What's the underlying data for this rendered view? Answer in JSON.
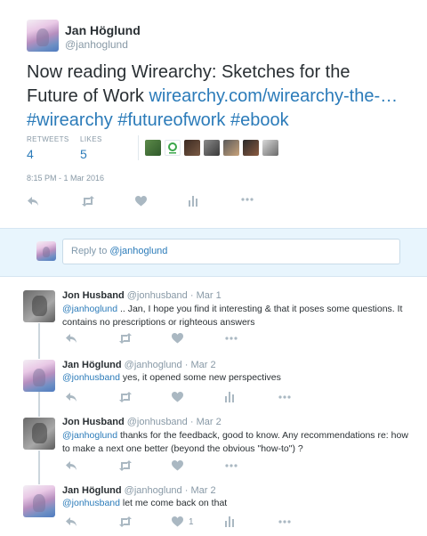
{
  "main_tweet": {
    "author_name": "Jan Höglund",
    "author_handle": "@janhoglund",
    "text_plain": "Now reading Wirearchy: Sketches for the Future of Work ",
    "text_link": "wirearchy.com/wirearchy-the-…",
    "hashtags": "#wirearchy #futureofwork #ebook",
    "retweets_label": "RETWEETS",
    "retweets_count": "4",
    "likes_label": "LIKES",
    "likes_count": "5",
    "timestamp": "8:15 PM - 1 Mar 2016",
    "liker_avatars": [
      "liker-1",
      "liker-2",
      "liker-3",
      "liker-4",
      "liker-5",
      "liker-6",
      "liker-7"
    ]
  },
  "reply_box": {
    "placeholder_prefix": "Reply to ",
    "placeholder_mention": "@janhoglund"
  },
  "replies": [
    {
      "name": "Jon Husband",
      "handle": "@jonhusband",
      "date": "· Mar 1",
      "mention": "@janhoglund",
      "text": " .. Jan, I hope you find it interesting & that it poses some questions.  It contains no prescriptions or righteous answers",
      "likes": ""
    },
    {
      "name": "Jan Höglund",
      "handle": "@janhoglund",
      "date": "· Mar 2",
      "mention": "@jonhusband",
      "text": " yes, it opened some new perspectives",
      "likes": ""
    },
    {
      "name": "Jon Husband",
      "handle": "@jonhusband",
      "date": "· Mar 2",
      "mention": "@janhoglund",
      "text": " thanks for the feedback, good to know.  Any recommendations re: how to make a next one better (beyond the obvious \"how-to\") ?",
      "likes": ""
    },
    {
      "name": "Jan Höglund",
      "handle": "@janhoglund",
      "date": "· Mar 2",
      "mention": "@jonhusband",
      "text": " let me come back on that",
      "likes": "1"
    }
  ],
  "icons": {
    "reply": "reply-icon",
    "retweet": "retweet-icon",
    "like": "heart-icon",
    "analytics": "analytics-icon",
    "more": "more-icon"
  },
  "colors": {
    "link": "#2b7bb9",
    "muted": "#8899a6",
    "icon": "#aab8c2",
    "reply_bar": "#e8f5fd"
  }
}
